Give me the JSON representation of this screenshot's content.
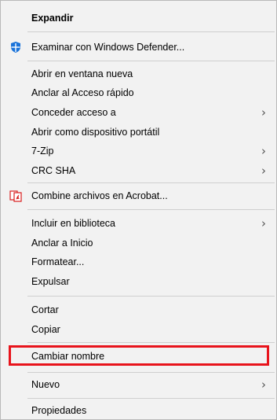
{
  "menu": {
    "items": [
      {
        "label": "Expandir"
      },
      {
        "label": "Examinar con Windows Defender..."
      },
      {
        "label": "Abrir en ventana nueva"
      },
      {
        "label": "Anclar al Acceso rápido"
      },
      {
        "label": "Conceder acceso a"
      },
      {
        "label": "Abrir como dispositivo portátil"
      },
      {
        "label": "7-Zip"
      },
      {
        "label": "CRC SHA"
      },
      {
        "label": "Combine archivos en Acrobat..."
      },
      {
        "label": "Incluir en biblioteca"
      },
      {
        "label": "Anclar a Inicio"
      },
      {
        "label": "Formatear..."
      },
      {
        "label": "Expulsar"
      },
      {
        "label": "Cortar"
      },
      {
        "label": "Copiar"
      },
      {
        "label": "Cambiar nombre"
      },
      {
        "label": "Nuevo"
      },
      {
        "label": "Propiedades"
      }
    ],
    "submenu_glyph": "›"
  },
  "colors": {
    "menu_bg": "#f2f2f2",
    "separator": "#cfcfcf",
    "highlight_border": "#e8141c",
    "defender_blue": "#1a73d9",
    "acrobat_red": "#d81e1e"
  }
}
